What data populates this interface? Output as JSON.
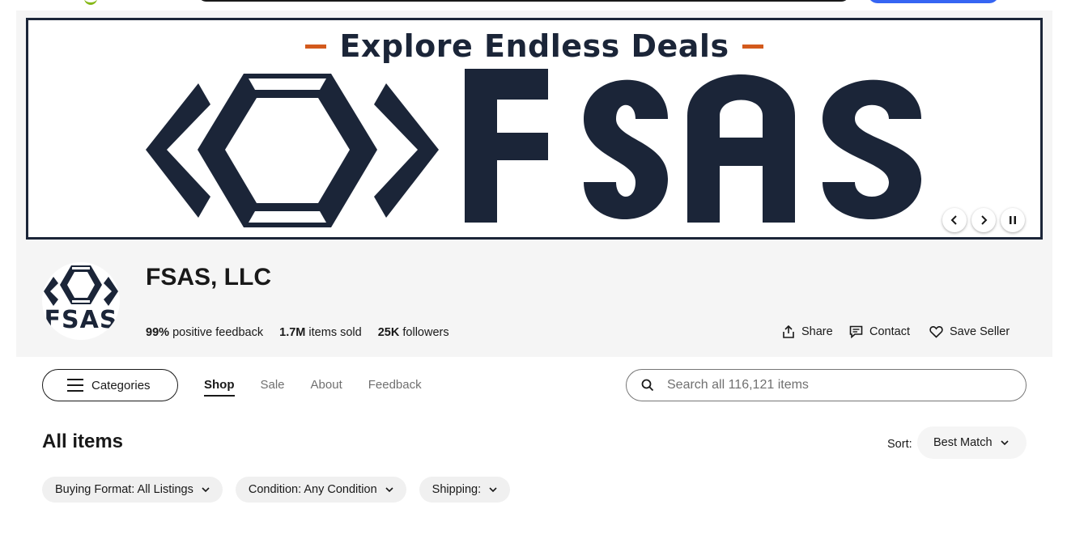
{
  "banner": {
    "headline": "Explore Endless Deals",
    "logo_text": "FSAS",
    "accent_color": "#d35a1c",
    "brand_color": "#1b2538",
    "controls": {
      "prev_icon": "chevron-left-icon",
      "next_icon": "chevron-right-icon",
      "pause_icon": "pause-icon"
    }
  },
  "seller": {
    "name": "FSAS, LLC",
    "avatar_text": "FSAS",
    "stats": [
      {
        "value": "99%",
        "label": "positive feedback"
      },
      {
        "value": "1.7M",
        "label": "items sold"
      },
      {
        "value": "25K",
        "label": "followers"
      }
    ],
    "actions": {
      "share": "Share",
      "contact": "Contact",
      "save": "Save Seller"
    }
  },
  "store_nav": {
    "categories_label": "Categories",
    "tabs": [
      {
        "label": "Shop",
        "active": true
      },
      {
        "label": "Sale",
        "active": false
      },
      {
        "label": "About",
        "active": false
      },
      {
        "label": "Feedback",
        "active": false
      }
    ],
    "search_placeholder": "Search all 116,121 items"
  },
  "listing": {
    "heading": "All items",
    "sort_label": "Sort:",
    "sort_value": "Best Match",
    "filters": [
      {
        "label": "Buying Format: All Listings"
      },
      {
        "label": "Condition: Any Condition"
      },
      {
        "label": "Shipping:"
      }
    ]
  }
}
